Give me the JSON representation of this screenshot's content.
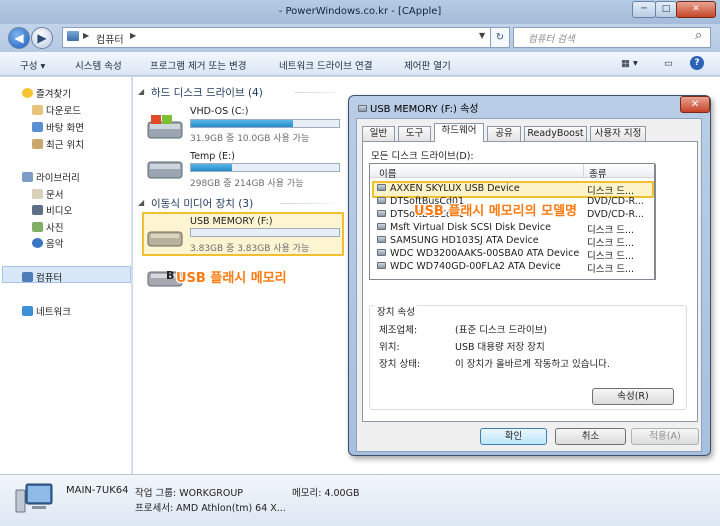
{
  "window": {
    "title": "- PowerWindows.co.kr - [CApple]",
    "min": "─",
    "max": "□",
    "close": "✕"
  },
  "address": {
    "back": "◀",
    "forward": "▶",
    "breadcrumb_sep": "▶",
    "path": "컴퓨터",
    "path_arrow": "▶",
    "dropdown": "▼",
    "refresh": "↻",
    "search_placeholder": "컴퓨터 검색",
    "search_icon": "⌕"
  },
  "commands": {
    "organize": "구성 ▾",
    "properties": "시스템 속성",
    "uninstall": "프로그램 제거 또는 변경",
    "map_drive": "네트워크 드라이브 연결",
    "control_panel": "제어판 열기",
    "view": "▦ ▾",
    "pane": "▭",
    "help": "?"
  },
  "nav": {
    "favorites": "즐겨찾기",
    "downloads": "다운로드",
    "desktop": "바탕 화면",
    "recent": "최근 위치",
    "libraries": "라이브러리",
    "documents": "문서",
    "videos": "비디오",
    "pictures": "사진",
    "music": "음악",
    "computer": "컴퓨터",
    "network": "네트워크"
  },
  "content": {
    "hdd_header": "하드 디스크 드라이브 (4)",
    "removable_header": "이동식 미디어 장치 (3)",
    "drives": [
      {
        "name": "VHD-OS (C:)",
        "free": "31.9GB 중 10.0GB 사용 가능",
        "used_fraction": 0.69
      },
      {
        "name": "Temp (E:)",
        "free": "298GB 중 214GB 사용 가능",
        "used_fraction": 0.28
      },
      {
        "name": "USB MEMORY (F:)",
        "free": "3.83GB 중 3.83GB 사용 가능",
        "used_fraction": 0.0
      }
    ],
    "b_label": "B"
  },
  "annotations": {
    "usb": "USB 플래시 메모리",
    "model": "USB 플래시 메모리의 모델명"
  },
  "details": {
    "name": "MAIN-7UK64",
    "workgroup": "작업 그룹: WORKGROUP",
    "memory": "메모리: 4.00GB",
    "processor": "프로세서: AMD Athlon(tm) 64 X..."
  },
  "dialog": {
    "title": "USB MEMORY (F:) 속성",
    "close": "✕",
    "tabs": [
      "일반",
      "도구",
      "하드웨어",
      "공유",
      "ReadyBoost",
      "사용자 지정"
    ],
    "all_drives_label": "모든 디스크 드라이브(D):",
    "col_name": "이름",
    "col_type": "종류",
    "devices": [
      {
        "name": "AXXEN SKYLUX USB Device",
        "type": "디스크 드..."
      },
      {
        "name": "DTSoftBusCd01",
        "type": "DVD/CD-R..."
      },
      {
        "name": "DTSoftBusCd02",
        "type": "DVD/CD-R..."
      },
      {
        "name": "Msft Virtual Disk SCSI Disk Device",
        "type": "디스크 드..."
      },
      {
        "name": "SAMSUNG HD103SJ ATA Device",
        "type": "디스크 드..."
      },
      {
        "name": "WDC WD3200AAKS-00SBA0 ATA Device",
        "type": "디스크 드..."
      },
      {
        "name": "WDC WD740GD-00FLA2 ATA Device",
        "type": "디스크 드..."
      }
    ],
    "device_props_label": "장치 속성",
    "manufacturer_label": "제조업체:",
    "manufacturer": "(표준 디스크 드라이브)",
    "location_label": "위치:",
    "location": "USB 대용량 저장 장치",
    "status_label": "장치 상태:",
    "status": "이 장치가 올바르게 작동하고 있습니다.",
    "properties_btn": "속성(R)",
    "ok_btn": "확인",
    "cancel_btn": "취소",
    "apply_btn": "적용(A)"
  }
}
